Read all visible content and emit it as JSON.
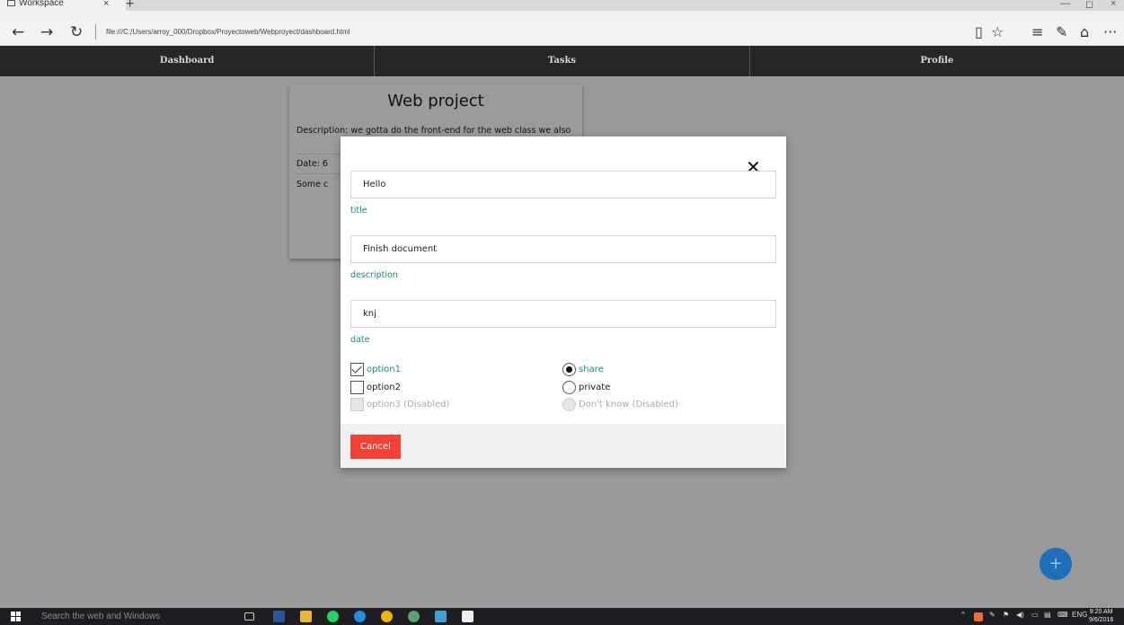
{
  "browser": {
    "tab_title": "Workspace",
    "tab_close": "×",
    "new_tab": "+",
    "url": "file:///C:/Users/arroy_000/Dropbox/Proyectoweb/Webproyect/dashboard.html",
    "back_icon": "arrow-left-icon",
    "forward_icon": "arrow-right-icon",
    "refresh_icon": "refresh-icon",
    "more": "···"
  },
  "nav": {
    "tabs": [
      "Dashboard",
      "Tasks",
      "Profile"
    ]
  },
  "card": {
    "title": "Web project",
    "description": "Description: we gotta do the front-end for the web class we also",
    "date": "Date: 6",
    "other": "Some c"
  },
  "modal": {
    "close": "✕",
    "fields": [
      {
        "value": "Hello",
        "label": "title"
      },
      {
        "value": "Finish document",
        "label": "description"
      },
      {
        "value": "knj",
        "label": "date"
      }
    ],
    "checkboxes": [
      {
        "label": "option1",
        "checked": true,
        "disabled": false
      },
      {
        "label": "option2",
        "checked": false,
        "disabled": false
      },
      {
        "label": "option3 (Disabled)",
        "checked": false,
        "disabled": true
      }
    ],
    "radios": [
      {
        "label": "share",
        "checked": true,
        "disabled": false
      },
      {
        "label": "private",
        "checked": false,
        "disabled": false
      },
      {
        "label": "Don't know (Disabled)",
        "checked": false,
        "disabled": true
      }
    ],
    "cancel_label": "Cancel"
  },
  "fab": {
    "label": "+"
  },
  "taskbar": {
    "search_placeholder": "Search the web and Windows",
    "lang": "ENG",
    "time": "9:20 AM",
    "date": "9/6/2016"
  },
  "colors": {
    "accent_teal": "#1a8a84",
    "cancel_red": "#f44336",
    "fab_blue": "#1f6fb8",
    "nav_bg": "#262626"
  }
}
